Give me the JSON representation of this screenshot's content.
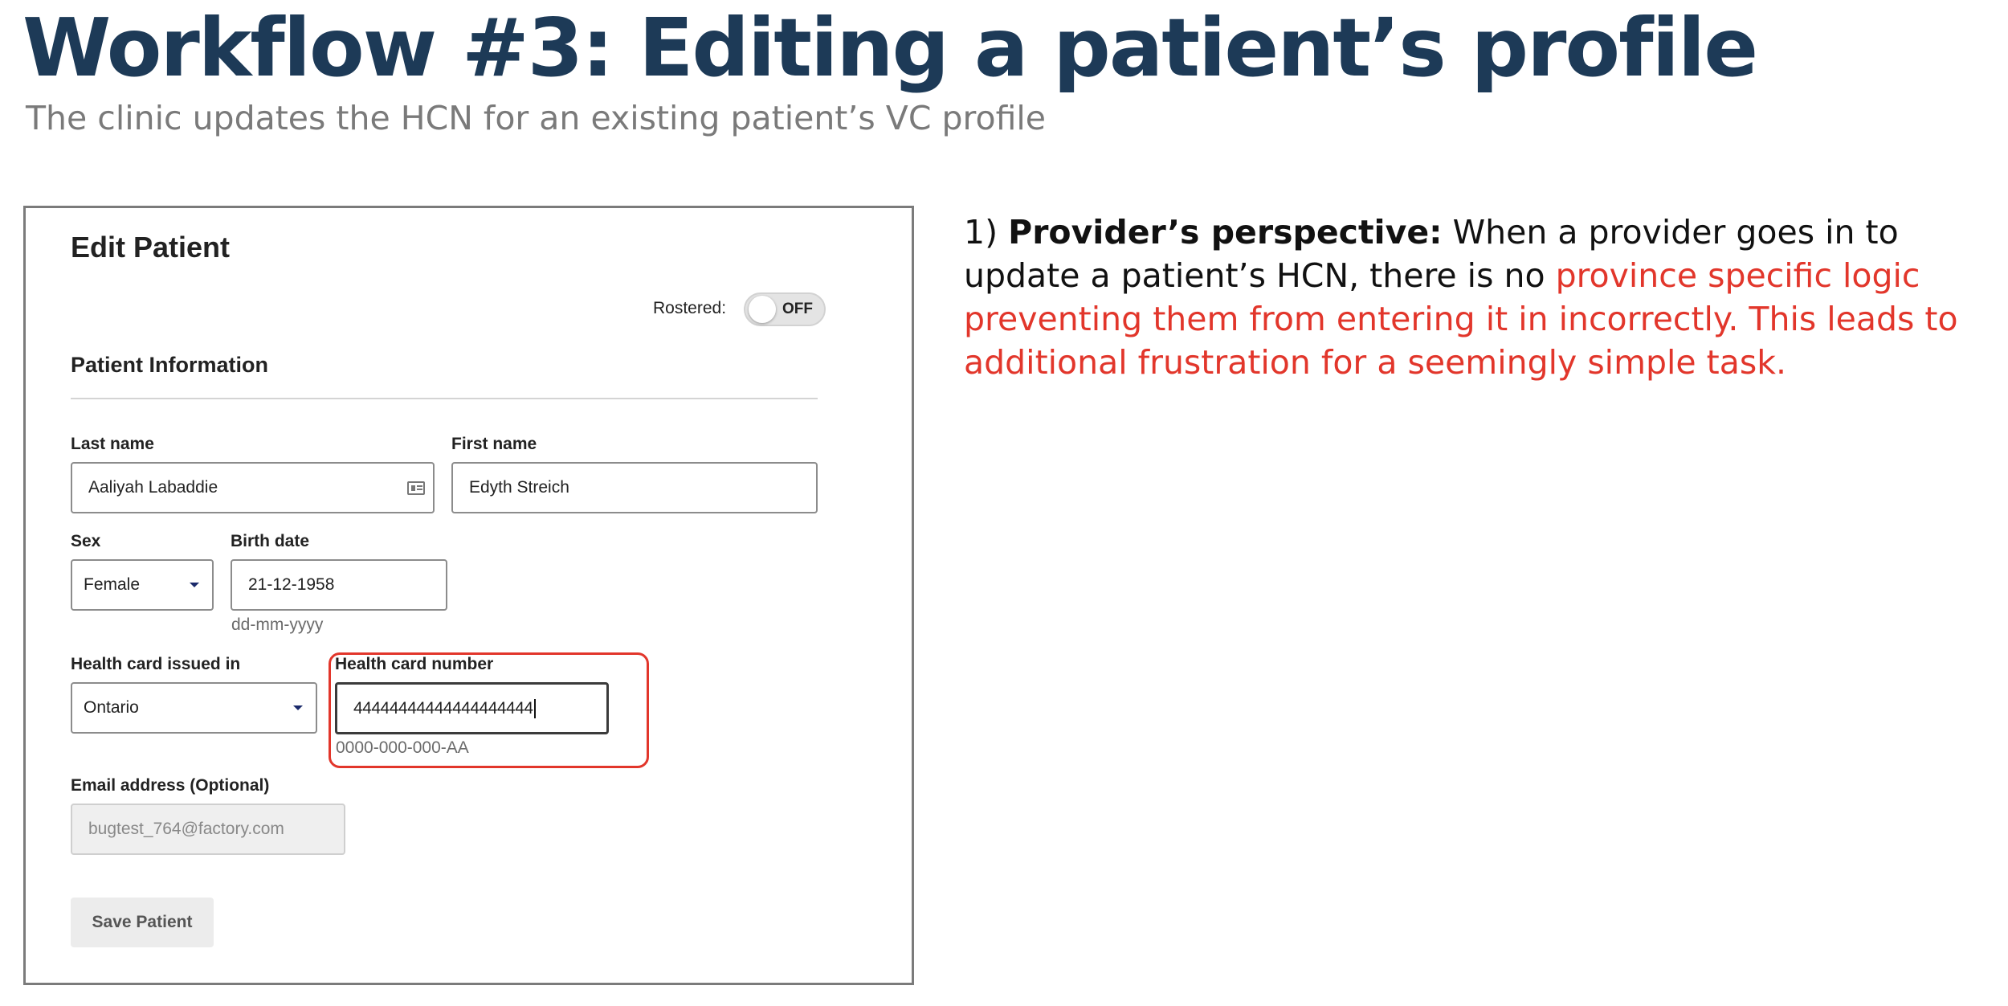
{
  "slide": {
    "title": "Workflow #3: Editing a patient’s profile",
    "subtitle": "The clinic updates the HCN for an existing patient’s VC profile"
  },
  "form": {
    "title": "Edit Patient",
    "rostered_label": "Rostered:",
    "rostered_toggle": "OFF",
    "section_title": "Patient Information",
    "last_name": {
      "label": "Last name",
      "value": "Aaliyah Labaddie"
    },
    "first_name": {
      "label": "First name",
      "value": "Edyth Streich"
    },
    "sex": {
      "label": "Sex",
      "value": "Female"
    },
    "birth_date": {
      "label": "Birth date",
      "value": "21-12-1958",
      "hint": "dd-mm-yyyy"
    },
    "health_card_issued_in": {
      "label": "Health card issued in",
      "value": "Ontario"
    },
    "health_card_number": {
      "label": "Health card number",
      "value": "44444444444444444444",
      "hint": "0000-000-000-AA"
    },
    "email": {
      "label": "Email address (Optional)",
      "value": "bugtest_764@factory.com"
    },
    "save_button": "Save Patient"
  },
  "commentary": {
    "number": "1)",
    "bold": "Provider’s perspective:",
    "plain": "When a provider goes in to update a patient’s HCN, there is no",
    "highlight": "province specific logic preventing them from entering it in incorrectly. This leads to additional frustration for a seemingly simple task."
  },
  "colors": {
    "title": "#1d3a57",
    "subtitle": "#7a7a7a",
    "highlight": "#e2362b"
  }
}
